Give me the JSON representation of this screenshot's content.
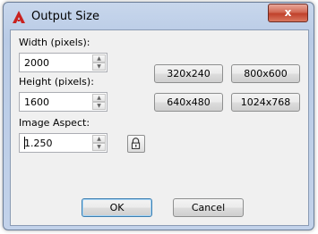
{
  "window": {
    "title": "Output Size",
    "close_label": "x"
  },
  "icons": {
    "app": "autocad-red-a-icon",
    "close": "close-icon",
    "lock": "lock-icon",
    "spin_up": "spin-up-arrow-icon",
    "spin_down": "spin-down-arrow-icon"
  },
  "colors": {
    "app_icon": "#c9221f",
    "close_button": "#c0412b",
    "default_button_border": "#3c7fb1"
  },
  "fields": {
    "width": {
      "label": "Width (pixels):",
      "value": "2000"
    },
    "height": {
      "label": "Height (pixels):",
      "value": "1600"
    },
    "aspect": {
      "label": "Image Aspect:",
      "value": "1.250"
    }
  },
  "presets": [
    "320x240",
    "800x600",
    "640x480",
    "1024x768"
  ],
  "buttons": {
    "ok": "OK",
    "cancel": "Cancel"
  }
}
